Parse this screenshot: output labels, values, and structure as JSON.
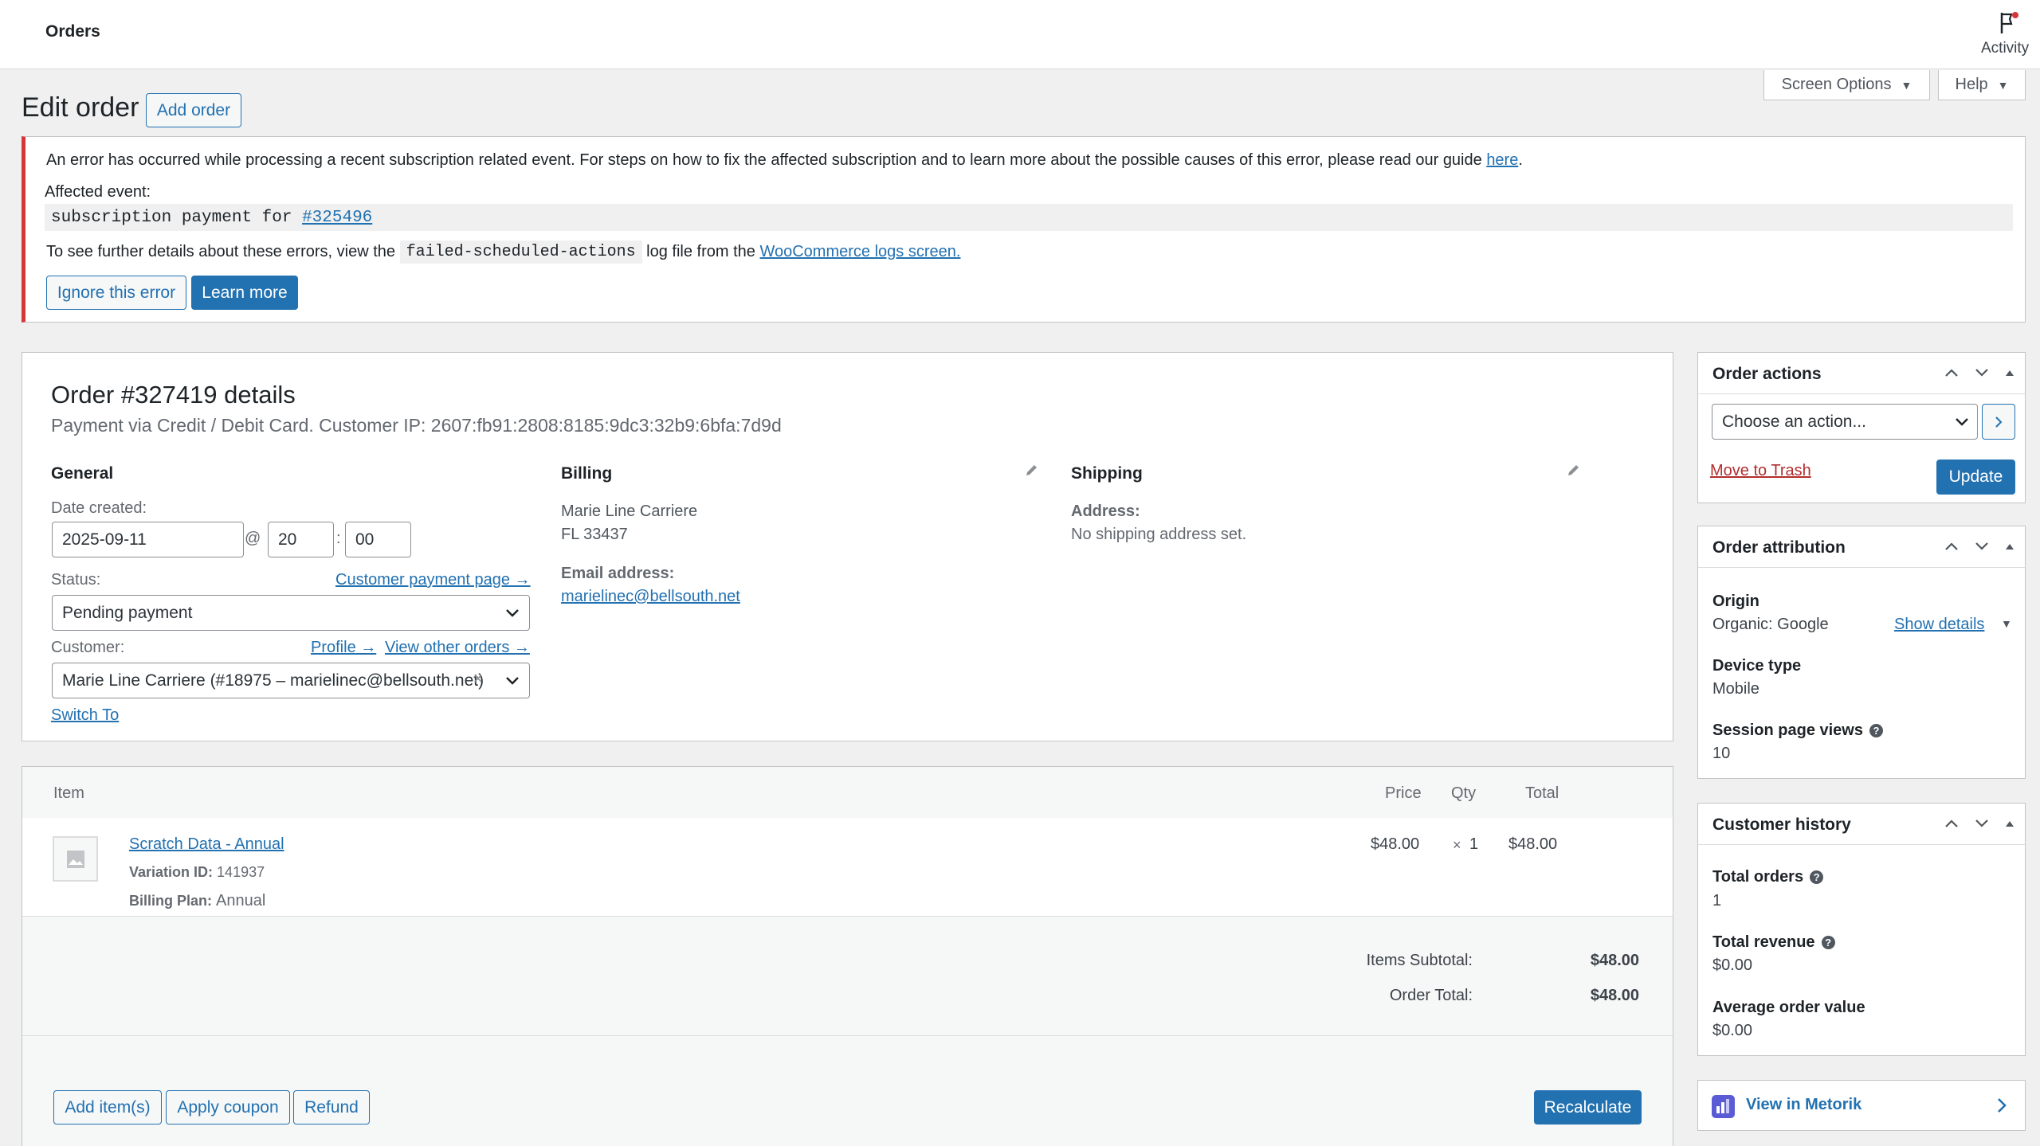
{
  "topbar": {
    "title": "Orders",
    "activity_label": "Activity"
  },
  "screen_options": {
    "screen_options_label": "Screen Options",
    "help_label": "Help"
  },
  "page": {
    "heading": "Edit order",
    "add_order_label": "Add order"
  },
  "notice": {
    "message": "An error has occurred while processing a recent subscription related event. For steps on how to fix the affected subscription and to learn more about the possible causes of this error, please read our guide ",
    "message_link": "here",
    "message_end": ".",
    "affected_label": "Affected event:",
    "code_prefix": "subscription payment for ",
    "code_link": "#325496",
    "details_prefix": "To see further details about these errors, view the ",
    "details_code": "failed-scheduled-actions",
    "details_mid": " log file from the ",
    "details_link": "WooCommerce logs screen.",
    "ignore_label": "Ignore this error",
    "learn_label": "Learn more"
  },
  "order": {
    "title": "Order #327419 details",
    "subtitle": "Payment via Credit / Debit Card. Customer IP: 2607:fb91:2808:8185:9dc3:32b9:6bfa:7d9d",
    "general_heading": "General",
    "date_label": "Date created:",
    "date_value": "2025-09-11",
    "at_sign": "@",
    "hour_value": "20",
    "colon": ":",
    "minute_value": "00",
    "status_label": "Status:",
    "customer_payment_link": "Customer payment page →",
    "status_value": "Pending payment",
    "customer_label": "Customer:",
    "profile_link": "Profile →",
    "other_orders_link": "View other orders →",
    "customer_value": "Marie Line Carriere (#18975 – marielinec@bellsouth.net)",
    "clear_symbol": "×",
    "switch_to": "Switch To",
    "billing_heading": "Billing",
    "billing_name": "Marie Line Carriere",
    "billing_region": "FL 33437",
    "email_label": "Email address:",
    "email_value": "marielinec@bellsouth.net",
    "shipping_heading": "Shipping",
    "shipping_address_label": "Address:",
    "shipping_address_value": "No shipping address set."
  },
  "items": {
    "headers": {
      "item": "Item",
      "price": "Price",
      "qty": "Qty",
      "total": "Total"
    },
    "row": {
      "name": "Scratch Data - Annual",
      "variation_label": "Variation ID:",
      "variation_value": "141937",
      "plan_label": "Billing Plan:",
      "plan_value": "Annual",
      "price": "$48.00",
      "qty_x": "×",
      "qty": "1",
      "total": "$48.00"
    },
    "subtotal_label": "Items Subtotal:",
    "subtotal_value": "$48.00",
    "total_label": "Order Total:",
    "total_value": "$48.00",
    "add_items_label": "Add item(s)",
    "coupon_label": "Apply coupon",
    "refund_label": "Refund",
    "recalculate_label": "Recalculate"
  },
  "order_actions": {
    "heading": "Order actions",
    "select_value": "Choose an action...",
    "trash_label": "Move to Trash",
    "update_label": "Update"
  },
  "attribution": {
    "heading": "Order attribution",
    "origin_label": "Origin",
    "origin_value": "Organic: Google",
    "show_details": "Show details",
    "device_label": "Device type",
    "device_value": "Mobile",
    "views_label": "Session page views",
    "views_value": "10"
  },
  "customer_history": {
    "heading": "Customer history",
    "orders_label": "Total orders",
    "orders_value": "1",
    "revenue_label": "Total revenue",
    "revenue_value": "$0.00",
    "avg_label": "Average order value",
    "avg_value": "$0.00"
  },
  "metorik": {
    "label": "View in Metorik"
  },
  "colors": {
    "accent": "#2271b1",
    "error": "#d63638",
    "trash": "#b32d2e"
  }
}
